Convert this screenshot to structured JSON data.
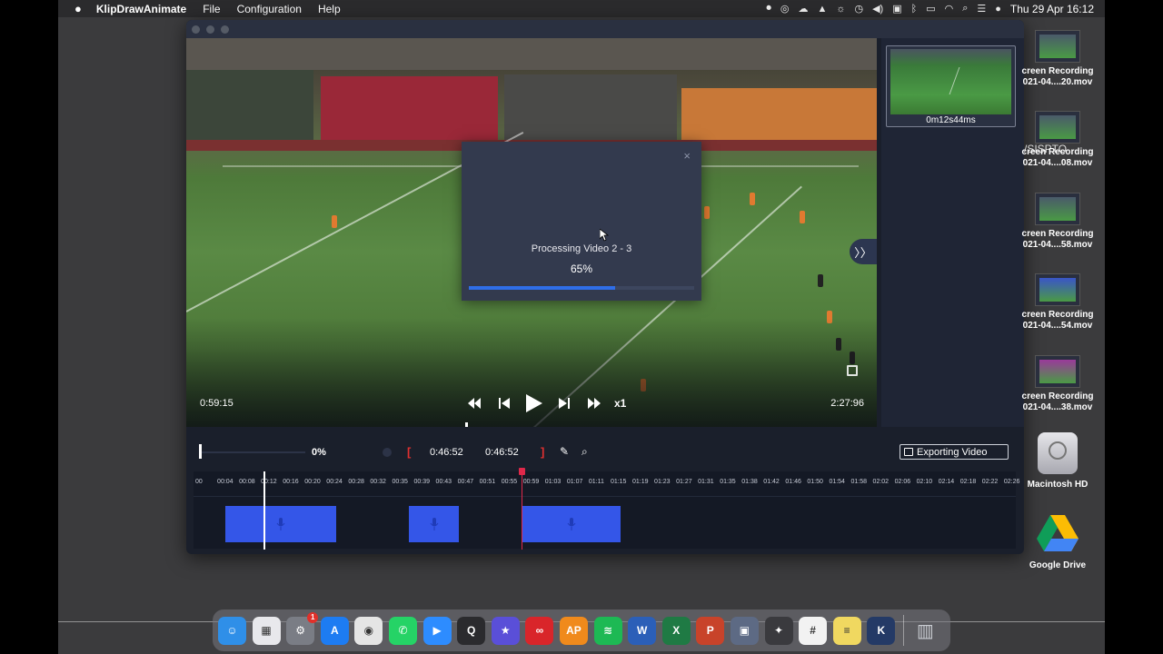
{
  "menubar": {
    "app_name": "KlipDrawAnimate",
    "menus": [
      "File",
      "Configuration",
      "Help"
    ],
    "clock": "Thu 29 Apr  16:12",
    "status_icons": [
      "record-icon",
      "creative-cloud-icon",
      "cloud-upload-icon",
      "app-icon",
      "lamp-icon",
      "time-machine-icon",
      "volume-icon",
      "uk-flag-icon",
      "bluetooth-icon",
      "battery-icon",
      "wifi-icon",
      "spotlight-icon",
      "control-center-icon",
      "siri-icon"
    ]
  },
  "player": {
    "current_time": "0:59:15",
    "total_time": "2:27:96",
    "speed": "x1",
    "seek_progress": 0.4
  },
  "modal": {
    "title": "Processing Video 2 - 3",
    "percent_text": "65%",
    "progress": 0.65,
    "close": "×"
  },
  "right_panel": {
    "thumbnail_label": "0m12s44ms",
    "collapse_glyph": "〉〉"
  },
  "toolbar": {
    "zoom_percent": "0%",
    "in_time": "0:46:52",
    "out_time": "0:46:52",
    "export_label": "Exporting Video",
    "bracket_open": "[",
    "bracket_close": "]"
  },
  "timeline": {
    "ticks": [
      "00",
      "00:04",
      "00:08",
      "00:12",
      "00:16",
      "00:20",
      "00:24",
      "00:28",
      "00:32",
      "00:35",
      "00:39",
      "00:43",
      "00:47",
      "00:51",
      "00:55",
      "00:59",
      "01:03",
      "01:07",
      "01:11",
      "01:15",
      "01:19",
      "01:23",
      "01:27",
      "01:31",
      "01:35",
      "01:38",
      "01:42",
      "01:46",
      "01:50",
      "01:54",
      "01:58",
      "02:02",
      "02:06",
      "02:10",
      "02:14",
      "02:18",
      "02:22",
      "02:26"
    ],
    "clips": [
      "audio-clip-1",
      "audio-clip-2",
      "audio-clip-3"
    ]
  },
  "desktop": {
    "files": [
      {
        "line1": "creen Recording",
        "line2": "021-04....20.mov"
      },
      {
        "line1": "creen Recording",
        "line2": "021-04....08.mov"
      },
      {
        "line1": "creen Recording",
        "line2": "021-04....58.mov"
      },
      {
        "line1": "creen Recording",
        "line2": "021-04....54.mov"
      },
      {
        "line1": "creen Recording",
        "line2": "021-04....38.mov"
      }
    ],
    "overlay_text": "/SISPTO",
    "drive1": "Macintosh HD",
    "drive2": "Google Drive"
  },
  "dock": {
    "apps": [
      {
        "name": "finder-icon",
        "color": "#2f8fe8",
        "glyph": "☺"
      },
      {
        "name": "launchpad-icon",
        "color": "#e8e8ec",
        "glyph": "▦"
      },
      {
        "name": "system-preferences-icon",
        "color": "#7a7d85",
        "glyph": "⚙",
        "badge": "1"
      },
      {
        "name": "app-store-icon",
        "color": "#1d7cf2",
        "glyph": "A"
      },
      {
        "name": "chrome-icon",
        "color": "#e5e5e5",
        "glyph": "◉"
      },
      {
        "name": "whatsapp-icon",
        "color": "#25d366",
        "glyph": "✆"
      },
      {
        "name": "zoom-icon",
        "color": "#2d8cff",
        "glyph": "▶"
      },
      {
        "name": "quicktime-icon",
        "color": "#2b2b2e",
        "glyph": "Q"
      },
      {
        "name": "imovie-icon",
        "color": "#5a4fd8",
        "glyph": "★"
      },
      {
        "name": "creative-cloud-icon",
        "color": "#d9252a",
        "glyph": "∞"
      },
      {
        "name": "ap-joystick-icon",
        "color": "#f08a1c",
        "glyph": "AP"
      },
      {
        "name": "spotify-icon",
        "color": "#1db954",
        "glyph": "≋"
      },
      {
        "name": "word-icon",
        "color": "#2b5fb8",
        "glyph": "W"
      },
      {
        "name": "excel-icon",
        "color": "#1f7a44",
        "glyph": "X"
      },
      {
        "name": "powerpoint-icon",
        "color": "#c8432a",
        "glyph": "P"
      },
      {
        "name": "photo-booth-icon",
        "color": "#5d6a84",
        "glyph": "▣"
      },
      {
        "name": "final-cut-icon",
        "color": "#3a3a3e",
        "glyph": "✦"
      },
      {
        "name": "slack-icon",
        "color": "#f2f2f2",
        "glyph": "#"
      },
      {
        "name": "stickies-icon",
        "color": "#f0d860",
        "glyph": "≡"
      },
      {
        "name": "klipdraw-icon",
        "color": "#243a66",
        "glyph": "K"
      }
    ],
    "trash": {
      "name": "trash-icon",
      "color": "#c9ccd2",
      "glyph": "🗑"
    }
  }
}
